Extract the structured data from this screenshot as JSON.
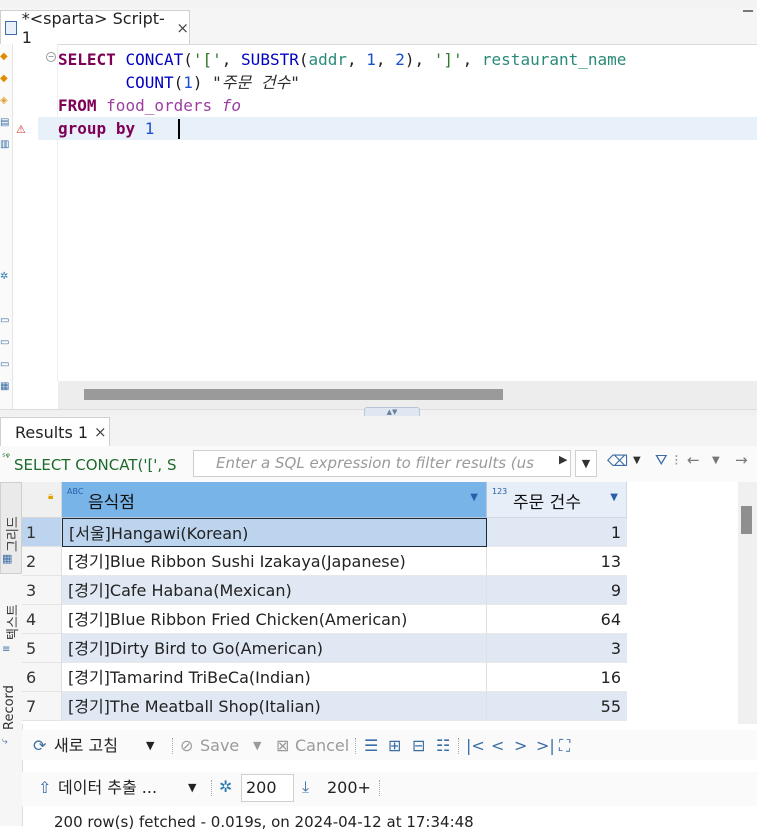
{
  "editor_tab": {
    "title": "*<sparta> Script-1",
    "close": "×"
  },
  "sql": {
    "line1": {
      "kw1": "SELECT",
      "fn1": "CONCAT",
      "p1": "(",
      "s1": "'['",
      "c1": ", ",
      "fn2": "SUBSTR",
      "p2": "(",
      "id1": "addr",
      "c2": ", ",
      "n1": "1",
      "c3": ", ",
      "n2": "2",
      "p3": "), ",
      "s2": "']'",
      "c4": ", ",
      "id2": "restaurant_name"
    },
    "line2": {
      "fn": "COUNT",
      "p1": "(",
      "n": "1",
      "p2": ") ",
      "alias": "\"주문 건수\""
    },
    "line3": {
      "kw": "FROM",
      "table": "food_orders",
      "alias": "fo"
    },
    "line4": {
      "kw1": "group",
      "kw2": "by",
      "n": "1"
    }
  },
  "results": {
    "tab_label": "Results 1",
    "tab_close": "×",
    "query_label": "SELECT CONCAT('[', S",
    "filter_placeholder": "Enter a SQL expression to filter results (us",
    "columns": [
      {
        "type": "ABC",
        "label": "음식점"
      },
      {
        "type": "123",
        "label": "주문 건수"
      }
    ],
    "rows": [
      {
        "n": "1",
        "name": "[서울]Hangawi(Korean)",
        "count": "1"
      },
      {
        "n": "2",
        "name": "[경기]Blue Ribbon Sushi Izakaya(Japanese)",
        "count": "13"
      },
      {
        "n": "3",
        "name": "[경기]Cafe Habana(Mexican)",
        "count": "9"
      },
      {
        "n": "4",
        "name": "[경기]Blue Ribbon Fried Chicken(American)",
        "count": "64"
      },
      {
        "n": "5",
        "name": "[경기]Dirty Bird to Go(American)",
        "count": "3"
      },
      {
        "n": "6",
        "name": "[경기]Tamarind TriBeCa(Indian)",
        "count": "16"
      },
      {
        "n": "7",
        "name": "[경기]The Meatball Shop(Italian)",
        "count": "55"
      }
    ],
    "side_tabs": {
      "grid": "그리드",
      "text": "텍스트",
      "record": "Record"
    }
  },
  "toolbar": {
    "refresh": "새로 고침",
    "save": "Save",
    "cancel": "Cancel",
    "export": "데이터 추출 ...",
    "fetch_size": "200",
    "fetch_more": "200+"
  },
  "status": "200 row(s) fetched - 0.019s, on 2024-04-12 at 17:34:48",
  "colors": {
    "header_selected": "#79b4e8",
    "row_alt": "#dfe8f3",
    "keyword": "#7f0055"
  }
}
